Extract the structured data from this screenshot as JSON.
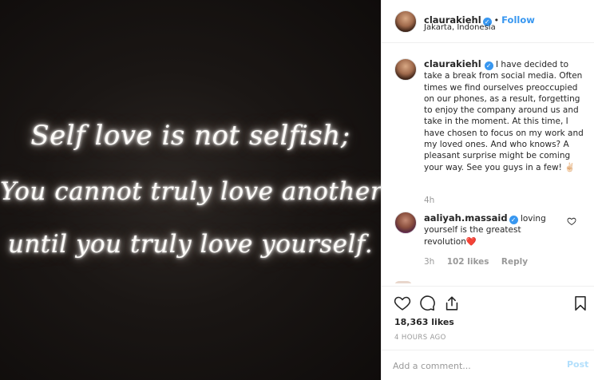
{
  "photo": {
    "quote_lines": [
      "Self love is not selfish;",
      "You cannot truly love another",
      "until you truly love yourself."
    ]
  },
  "post": {
    "username": "claurakiehl",
    "follow_label": "Follow",
    "separator": "•",
    "location": "Jakarta, Indonesia"
  },
  "caption": {
    "username": "claurakiehl",
    "text": "I have decided to take a break from social media. Often times we find ourselves preoccupied on our phones, as a result, forgetting to enjoy the company around us and take in the moment. At this time, I have chosen to focus on my work and my loved ones. And who knows? A pleasant surprise might be coming your way. See you guys in a few! ✌🏻",
    "time": "4h"
  },
  "comment": {
    "username": "aaliyah.massaid",
    "text": "loving yourself is the greatest revolution❤️",
    "time": "3h",
    "likes": "102 likes",
    "reply_label": "Reply"
  },
  "stats": {
    "likes": "18,363 likes",
    "posted": "4 HOURS AGO"
  },
  "add_comment": {
    "placeholder": "Add a comment...",
    "post_label": "Post"
  },
  "colors": {
    "link": "#3897f0",
    "verified": "#3897f0",
    "muted": "#999999",
    "post_disabled": "#b2dffc"
  },
  "icons": {
    "verified": "verified-badge-icon",
    "like": "heart-icon",
    "comment": "comment-bubble-icon",
    "share": "share-icon",
    "save": "bookmark-icon",
    "comment_like": "small-heart-icon"
  }
}
